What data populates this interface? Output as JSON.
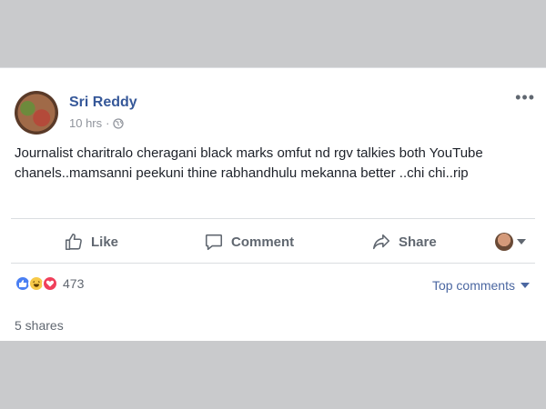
{
  "post": {
    "author": "Sri Reddy",
    "time": "10 hrs",
    "separator": "·",
    "text": "Journalist charitralo cheragani black marks omfut nd rgv talkies both YouTube chanels..mamsanni peekuni thine rabhandhulu mekanna better ..chi chi..rip",
    "more_icon": "ellipsis-icon",
    "privacy_icon": "globe-icon"
  },
  "actions": {
    "like": "Like",
    "comment": "Comment",
    "share": "Share"
  },
  "reactions": {
    "icons": [
      "like-icon",
      "haha-icon",
      "love-icon"
    ],
    "count": "473"
  },
  "comments_filter": "Top comments",
  "shares": "5 shares",
  "colors": {
    "author": "#365899",
    "link": "#4b67a1",
    "muted": "#606770",
    "background": "#c9cacc"
  }
}
